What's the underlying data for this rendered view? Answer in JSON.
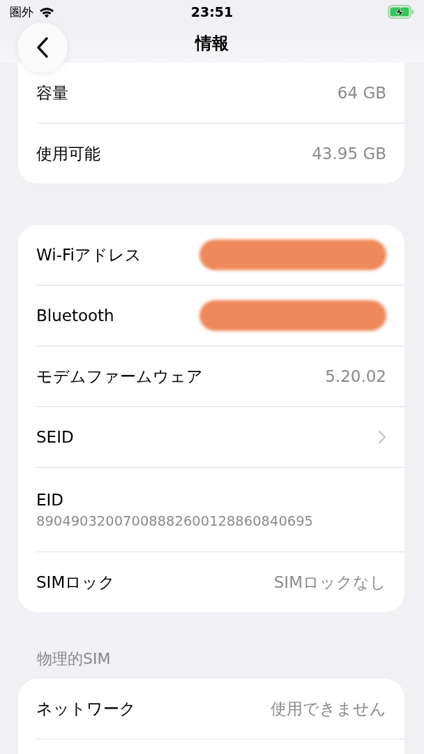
{
  "status_bar": {
    "carrier": "圏外",
    "time": "23:51"
  },
  "nav": {
    "title": "情報"
  },
  "groups": [
    {
      "rows": [
        {
          "kind": "value",
          "label": "容量",
          "value": "64 GB"
        },
        {
          "kind": "value",
          "label": "使用可能",
          "value": "43.95 GB"
        }
      ]
    },
    {
      "rows": [
        {
          "kind": "redacted",
          "label": "Wi-Fiアドレス"
        },
        {
          "kind": "redacted",
          "label": "Bluetooth"
        },
        {
          "kind": "value",
          "label": "モデムファームウェア",
          "value": "5.20.02"
        },
        {
          "kind": "chevron",
          "label": "SEID"
        },
        {
          "kind": "stacked",
          "label": "EID",
          "value": "89049032007008882600128860840695"
        },
        {
          "kind": "value",
          "label": "SIMロック",
          "value": "SIMロックなし"
        }
      ]
    },
    {
      "header": "物理的SIM",
      "rows": [
        {
          "kind": "value",
          "label": "ネットワーク",
          "value": "使用できません"
        }
      ]
    }
  ]
}
